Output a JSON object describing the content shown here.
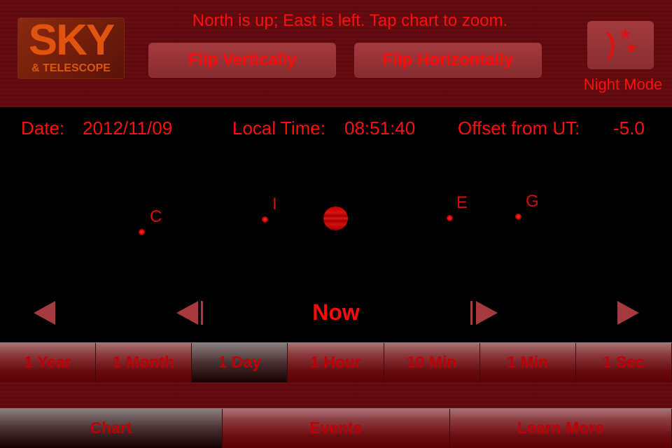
{
  "header": {
    "logo": {
      "line1": "SKY",
      "line2": "& TELESCOPE"
    },
    "hint": "North is up; East is left. Tap chart to zoom.",
    "flip_vertical": "Flip Vertically",
    "flip_horizontal": "Flip Horizontally",
    "night_mode": {
      "label": "Night Mode",
      "icon": "moon-stars-icon"
    }
  },
  "info": {
    "date_label": "Date:",
    "date": "2012/11/09",
    "time_label": "Local Time:",
    "time": "08:51:40",
    "offset_label": "Offset from UT:",
    "offset": "-5.0"
  },
  "chart": {
    "planet": "jupiter",
    "moons": [
      {
        "label": "C"
      },
      {
        "label": "I"
      },
      {
        "label": "E"
      },
      {
        "label": "G"
      }
    ]
  },
  "controls": {
    "now": "Now",
    "icons": [
      "back-fast-icon",
      "step-back-icon",
      "step-forward-icon",
      "forward-fast-icon"
    ]
  },
  "steps": {
    "items": [
      "1 Year",
      "1 Month",
      "1 Day",
      "1 Hour",
      "10 Min",
      "1 Min",
      "1 Sec"
    ],
    "selected": "1 Day"
  },
  "tabs": {
    "items": [
      "Chart",
      "Events",
      "Learn More"
    ],
    "selected": "Chart"
  },
  "colors": {
    "text": "#ff1010",
    "wood": "#620b0f",
    "button": "#a63a3e"
  }
}
